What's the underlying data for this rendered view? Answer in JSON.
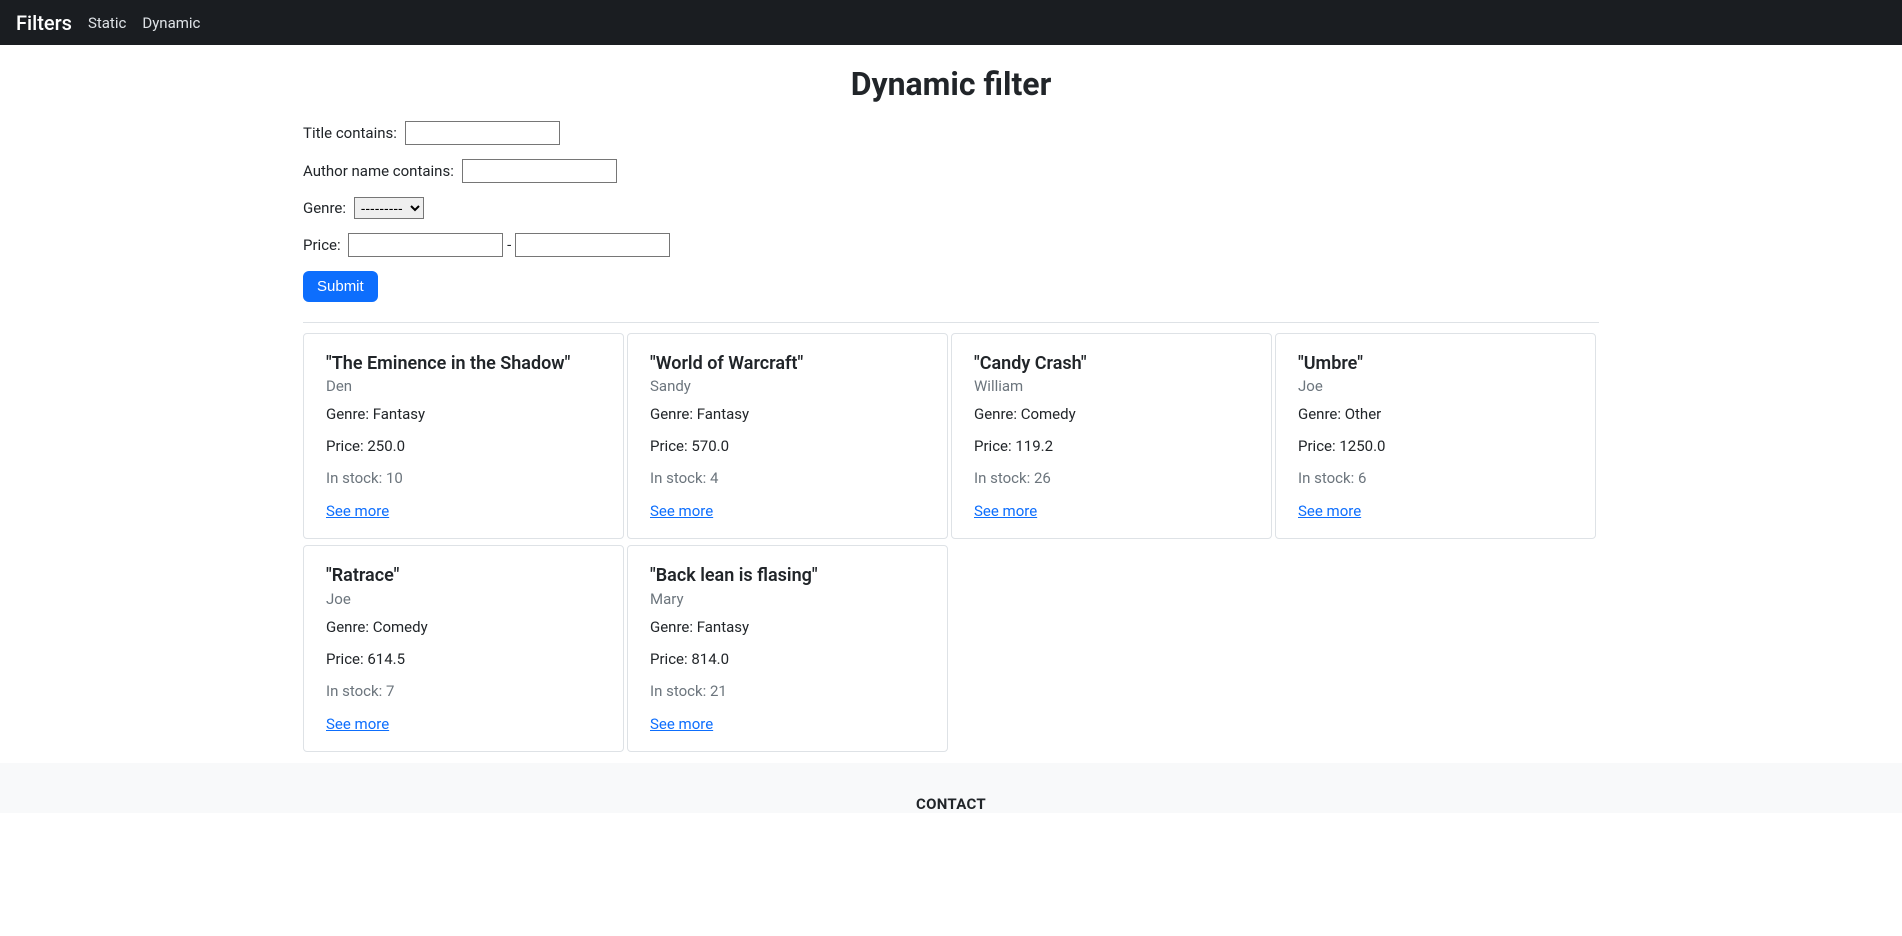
{
  "navbar": {
    "brand": "Filters",
    "links": [
      "Static",
      "Dynamic"
    ]
  },
  "page": {
    "title": "Dynamic filter"
  },
  "form": {
    "title_label": "Title contains:",
    "title_value": "",
    "author_label": "Author name contains:",
    "author_value": "",
    "genre_label": "Genre:",
    "genre_selected": "---------",
    "price_label": "Price:",
    "price_min": "",
    "price_max": "",
    "price_sep": "-",
    "submit_label": "Submit"
  },
  "books": [
    {
      "title": "\"The Eminence in the Shadow\"",
      "author": "Den",
      "genre": "Genre: Fantasy",
      "price": "Price: 250.0",
      "stock": "In stock: 10",
      "link": "See more"
    },
    {
      "title": "\"World of Warcraft\"",
      "author": "Sandy",
      "genre": "Genre: Fantasy",
      "price": "Price: 570.0",
      "stock": "In stock: 4",
      "link": "See more"
    },
    {
      "title": "\"Candy Crash\"",
      "author": "William",
      "genre": "Genre: Comedy",
      "price": "Price: 119.2",
      "stock": "In stock: 26",
      "link": "See more"
    },
    {
      "title": "\"Umbre\"",
      "author": "Joe",
      "genre": "Genre: Other",
      "price": "Price: 1250.0",
      "stock": "In stock: 6",
      "link": "See more"
    },
    {
      "title": "\"Ratrace\"",
      "author": "Joe",
      "genre": "Genre: Comedy",
      "price": "Price: 614.5",
      "stock": "In stock: 7",
      "link": "See more"
    },
    {
      "title": "\"Back lean is flasing\"",
      "author": "Mary",
      "genre": "Genre: Fantasy",
      "price": "Price: 814.0",
      "stock": "In stock: 21",
      "link": "See more"
    }
  ],
  "footer": {
    "contact": "CONTACT"
  }
}
